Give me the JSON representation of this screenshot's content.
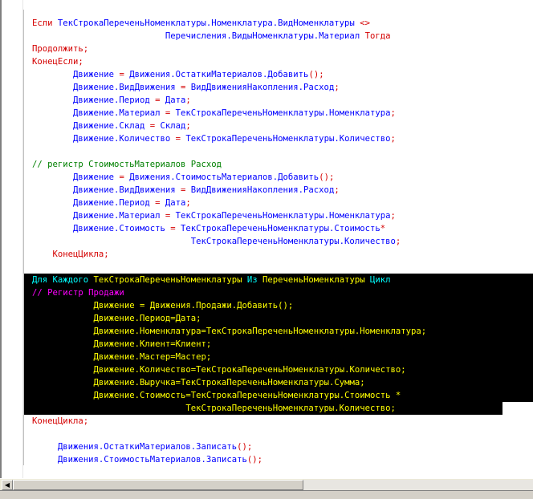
{
  "scroll": {
    "left_arrow": "◀"
  },
  "code": {
    "lines": [
      {
        "indent": "",
        "selected": false,
        "tokens": [
          {
            "t": "kw",
            "v": "Если "
          },
          {
            "t": "id",
            "v": "ТекСтрокаПереченьНоменклатуры.Номенклатура.ВидНоменклатуры "
          },
          {
            "t": "op",
            "v": "<>"
          }
        ]
      },
      {
        "indent": "                          ",
        "selected": false,
        "tokens": [
          {
            "t": "id",
            "v": "Перечисления.ВидыНоменклатуры.Материал "
          },
          {
            "t": "kw",
            "v": "Тогда"
          }
        ]
      },
      {
        "indent": "",
        "selected": false,
        "tokens": [
          {
            "t": "kw",
            "v": "Продолжить"
          },
          {
            "t": "op",
            "v": ";"
          }
        ]
      },
      {
        "indent": "",
        "selected": false,
        "tokens": [
          {
            "t": "kw",
            "v": "КонецЕсли"
          },
          {
            "t": "op",
            "v": ";"
          }
        ]
      },
      {
        "indent": "        ",
        "selected": false,
        "tokens": [
          {
            "t": "id",
            "v": "Движение "
          },
          {
            "t": "op",
            "v": "= "
          },
          {
            "t": "id",
            "v": "Движения.ОстаткиМатериалов.Добавить"
          },
          {
            "t": "op",
            "v": "();"
          }
        ]
      },
      {
        "indent": "        ",
        "selected": false,
        "tokens": [
          {
            "t": "id",
            "v": "Движение.ВидДвижения "
          },
          {
            "t": "op",
            "v": "= "
          },
          {
            "t": "id",
            "v": "ВидДвиженияНакопления.Расход"
          },
          {
            "t": "op",
            "v": ";"
          }
        ]
      },
      {
        "indent": "        ",
        "selected": false,
        "tokens": [
          {
            "t": "id",
            "v": "Движение.Период "
          },
          {
            "t": "op",
            "v": "= "
          },
          {
            "t": "id",
            "v": "Дата"
          },
          {
            "t": "op",
            "v": ";"
          }
        ]
      },
      {
        "indent": "        ",
        "selected": false,
        "tokens": [
          {
            "t": "id",
            "v": "Движение.Материал "
          },
          {
            "t": "op",
            "v": "= "
          },
          {
            "t": "id",
            "v": "ТекСтрокаПереченьНоменклатуры.Номенклатура"
          },
          {
            "t": "op",
            "v": ";"
          }
        ]
      },
      {
        "indent": "        ",
        "selected": false,
        "tokens": [
          {
            "t": "id",
            "v": "Движение.Склад "
          },
          {
            "t": "op",
            "v": "= "
          },
          {
            "t": "id",
            "v": "Склад"
          },
          {
            "t": "op",
            "v": ";"
          }
        ]
      },
      {
        "indent": "        ",
        "selected": false,
        "tokens": [
          {
            "t": "id",
            "v": "Движение.Количество "
          },
          {
            "t": "op",
            "v": "= "
          },
          {
            "t": "id",
            "v": "ТекСтрокаПереченьНоменклатуры.Количество"
          },
          {
            "t": "op",
            "v": ";"
          }
        ]
      },
      {
        "indent": "",
        "selected": false,
        "tokens": []
      },
      {
        "indent": "",
        "selected": false,
        "tokens": [
          {
            "t": "cm",
            "v": "// регистр СтоимостьМатериалов Расход"
          }
        ]
      },
      {
        "indent": "        ",
        "selected": false,
        "tokens": [
          {
            "t": "id",
            "v": "Движение "
          },
          {
            "t": "op",
            "v": "= "
          },
          {
            "t": "id",
            "v": "Движения.СтоимостьМатериалов.Добавить"
          },
          {
            "t": "op",
            "v": "();"
          }
        ]
      },
      {
        "indent": "        ",
        "selected": false,
        "tokens": [
          {
            "t": "id",
            "v": "Движение.ВидДвижения "
          },
          {
            "t": "op",
            "v": "= "
          },
          {
            "t": "id",
            "v": "ВидДвиженияНакопления.Расход"
          },
          {
            "t": "op",
            "v": ";"
          }
        ]
      },
      {
        "indent": "        ",
        "selected": false,
        "tokens": [
          {
            "t": "id",
            "v": "Движение.Период "
          },
          {
            "t": "op",
            "v": "= "
          },
          {
            "t": "id",
            "v": "Дата"
          },
          {
            "t": "op",
            "v": ";"
          }
        ]
      },
      {
        "indent": "        ",
        "selected": false,
        "tokens": [
          {
            "t": "id",
            "v": "Движение.Материал "
          },
          {
            "t": "op",
            "v": "= "
          },
          {
            "t": "id",
            "v": "ТекСтрокаПереченьНоменклатуры.Номенклатура"
          },
          {
            "t": "op",
            "v": ";"
          }
        ]
      },
      {
        "indent": "        ",
        "selected": false,
        "tokens": [
          {
            "t": "id",
            "v": "Движение.Стоимость "
          },
          {
            "t": "op",
            "v": "= "
          },
          {
            "t": "id",
            "v": "ТекСтрокаПереченьНоменклатуры.Стоимость"
          },
          {
            "t": "op",
            "v": "*"
          }
        ]
      },
      {
        "indent": "                               ",
        "selected": false,
        "tokens": [
          {
            "t": "id",
            "v": "ТекСтрокаПереченьНоменклатуры.Количество"
          },
          {
            "t": "op",
            "v": ";"
          }
        ]
      },
      {
        "indent": "    ",
        "selected": false,
        "tokens": [
          {
            "t": "kw",
            "v": "КонецЦикла"
          },
          {
            "t": "op",
            "v": ";"
          }
        ]
      },
      {
        "indent": "",
        "selected": false,
        "tokens": []
      },
      {
        "indent": "",
        "selected": true,
        "tokens": [
          {
            "t": "key2",
            "v": "Для Каждого "
          },
          {
            "t": "id",
            "v": "ТекСтрокаПереченьНоменклатуры "
          },
          {
            "t": "key2",
            "v": "Из "
          },
          {
            "t": "id",
            "v": "ПереченьНоменклатуры "
          },
          {
            "t": "key2",
            "v": "Цикл"
          }
        ]
      },
      {
        "indent": "",
        "selected": true,
        "tokens": [
          {
            "t": "cm",
            "v": "// Регистр Продажи"
          }
        ]
      },
      {
        "indent": "            ",
        "selected": true,
        "tokens": [
          {
            "t": "id",
            "v": "Движение "
          },
          {
            "t": "op",
            "v": "= "
          },
          {
            "t": "id",
            "v": "Движения.Продажи.Добавить"
          },
          {
            "t": "op",
            "v": "();"
          }
        ]
      },
      {
        "indent": "            ",
        "selected": true,
        "tokens": [
          {
            "t": "id",
            "v": "Движение.Период"
          },
          {
            "t": "op",
            "v": "="
          },
          {
            "t": "id",
            "v": "Дата"
          },
          {
            "t": "op",
            "v": ";"
          }
        ]
      },
      {
        "indent": "            ",
        "selected": true,
        "tokens": [
          {
            "t": "id",
            "v": "Движение.Номенклатура"
          },
          {
            "t": "op",
            "v": "="
          },
          {
            "t": "id",
            "v": "ТекСтрокаПереченьНоменклатуры.Номенклатура"
          },
          {
            "t": "op",
            "v": ";"
          }
        ]
      },
      {
        "indent": "            ",
        "selected": true,
        "tokens": [
          {
            "t": "id",
            "v": "Движение.Клиент"
          },
          {
            "t": "op",
            "v": "="
          },
          {
            "t": "id",
            "v": "Клиент"
          },
          {
            "t": "op",
            "v": ";"
          }
        ]
      },
      {
        "indent": "            ",
        "selected": true,
        "tokens": [
          {
            "t": "id",
            "v": "Движение.Мастер"
          },
          {
            "t": "op",
            "v": "="
          },
          {
            "t": "id",
            "v": "Мастер"
          },
          {
            "t": "op",
            "v": ";"
          }
        ]
      },
      {
        "indent": "            ",
        "selected": true,
        "tokens": [
          {
            "t": "id",
            "v": "Движение.Количество"
          },
          {
            "t": "op",
            "v": "="
          },
          {
            "t": "id",
            "v": "ТекСтрокаПереченьНоменклатуры.Количество"
          },
          {
            "t": "op",
            "v": ";"
          }
        ]
      },
      {
        "indent": "            ",
        "selected": true,
        "tokens": [
          {
            "t": "id",
            "v": "Движение.Выручка"
          },
          {
            "t": "op",
            "v": "="
          },
          {
            "t": "id",
            "v": "ТекСтрокаПереченьНоменклатуры.Сумма"
          },
          {
            "t": "op",
            "v": ";"
          }
        ]
      },
      {
        "indent": "            ",
        "selected": true,
        "tokens": [
          {
            "t": "id",
            "v": "Движение.Стоимость"
          },
          {
            "t": "op",
            "v": "="
          },
          {
            "t": "id",
            "v": "ТекСтрокаПереченьНоменклатуры.Стоимость "
          },
          {
            "t": "op",
            "v": "*"
          }
        ]
      },
      {
        "indent": "                              ",
        "selected": true,
        "partial": true,
        "tokens": [
          {
            "t": "id",
            "v": "ТекСтрокаПереченьНоменклатуры.Количество"
          },
          {
            "t": "op",
            "v": ";"
          }
        ]
      },
      {
        "indent": "",
        "selected": false,
        "tokens": [
          {
            "t": "kw",
            "v": "КонецЦикла"
          },
          {
            "t": "op",
            "v": ";"
          }
        ]
      },
      {
        "indent": "",
        "selected": false,
        "tokens": []
      },
      {
        "indent": "     ",
        "selected": false,
        "tokens": [
          {
            "t": "id",
            "v": "Движения.ОстаткиМатериалов.Записать"
          },
          {
            "t": "op",
            "v": "();"
          }
        ]
      },
      {
        "indent": "     ",
        "selected": false,
        "tokens": [
          {
            "t": "id",
            "v": "Движения.СтоимостьМатериалов.Записать"
          },
          {
            "t": "op",
            "v": "();"
          }
        ]
      }
    ]
  }
}
